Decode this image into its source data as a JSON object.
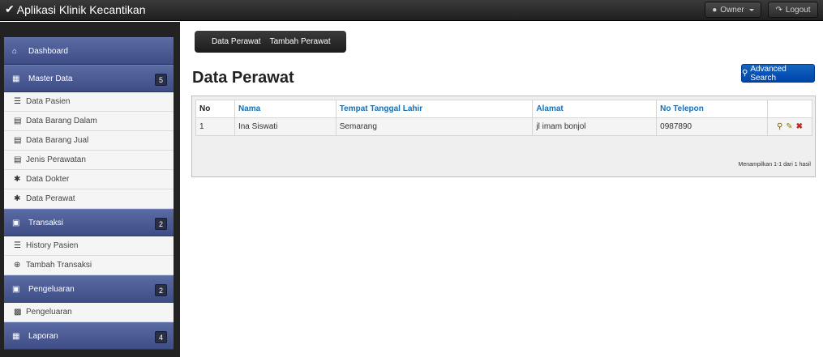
{
  "app": {
    "title": "Aplikasi Klinik Kecantikan",
    "owner_label": "Owner",
    "logout_label": "Logout"
  },
  "sidebar": {
    "dashboard": "Dashboard",
    "master": {
      "label": "Master Data",
      "count": "5"
    },
    "master_items": [
      "Data Pasien",
      "Data Barang Dalam",
      "Data Barang Jual",
      "Jenis Perawatan",
      "Data Dokter",
      "Data Perawat"
    ],
    "transaksi": {
      "label": "Transaksi",
      "count": "2"
    },
    "transaksi_items": [
      "History Pasien",
      "Tambah Transaksi"
    ],
    "pengeluaran": {
      "label": "Pengeluaran",
      "count": "2"
    },
    "pengeluaran_items": [
      "Pengeluaran"
    ],
    "laporan": {
      "label": "Laporan",
      "count": "4"
    }
  },
  "tabs": [
    "Data Perawat",
    "Tambah Perawat"
  ],
  "page": {
    "title": "Data Perawat",
    "advanced_search": "Advanced Search"
  },
  "table": {
    "headers": [
      "No",
      "Nama",
      "Tempat Tanggal Lahir",
      "Alamat",
      "No Telepon"
    ],
    "rows": [
      [
        "1",
        "Ina Siswati",
        "Semarang",
        "jl imam bonjol",
        "0987890"
      ]
    ],
    "summary": "Menampilkan 1-1 dari 1 hasil"
  },
  "colors": {
    "accent": "#0044aa",
    "sidebar_header": "#4a5a96",
    "link": "#1a6fb0"
  }
}
